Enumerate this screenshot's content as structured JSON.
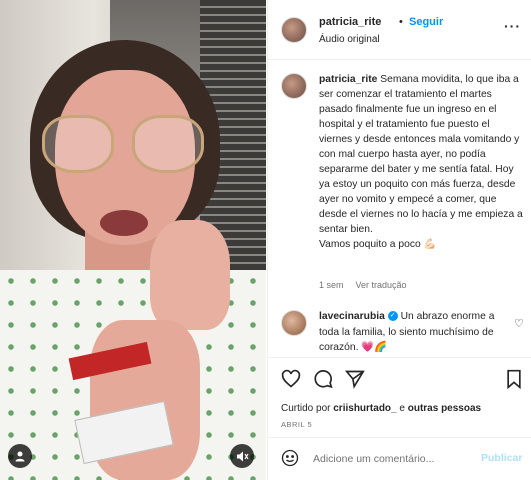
{
  "header": {
    "username": "patricia_rite",
    "separator": "•",
    "follow_label": "Seguir",
    "audio_label": "Áudio original",
    "more_icon": "more-horizontal-icon"
  },
  "caption": {
    "username": "patricia_rite",
    "text": "Semana movidita, lo que iba a ser comenzar el tratamiento el martes pasado finalmente fue un ingreso en el hospital y el tratamiento fue puesto el viernes y desde entonces mala vomitando y con mal cuerpo hasta ayer, no podía separarme del bater y me sentía fatal. Hoy ya estoy un poquito con más fuerza, desde ayer no vomito y empecé a comer, que desde el viernes no lo hacía y me empieza a sentar bien.",
    "text2": "Vamos poquito a poco 💪🏻",
    "age": "1 sem",
    "see_translation": "Ver tradução"
  },
  "comment": {
    "username": "lavecinarubia",
    "text": "Un abrazo enorme a toda la familia, lo siento muchísimo de corazón. 💗🌈"
  },
  "actions": {
    "liked_prefix": "Curtido por ",
    "liked_user": "criishurtado_",
    "liked_mid": " e ",
    "liked_others": "outras pessoas",
    "date": "ABRIL 5"
  },
  "compose": {
    "placeholder": "Adicione um comentário...",
    "publish_label": "Publicar"
  },
  "colors": {
    "accent": "#0095f6",
    "publish_disabled": "#b2dffc",
    "muted_text": "#737373"
  }
}
